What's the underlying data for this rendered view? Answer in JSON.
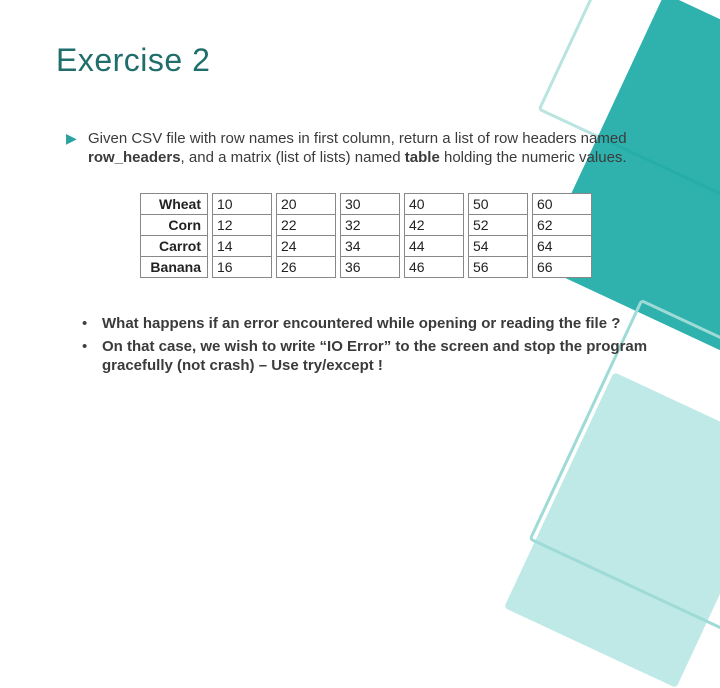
{
  "title": "Exercise 2",
  "bullet": {
    "pre": "Given CSV file with row names in first column, return a list of row headers named ",
    "kw1": "row_headers",
    "mid": ", and a matrix (list of lists) named ",
    "kw2": "table",
    "post": " holding the numeric values."
  },
  "table": {
    "rows": [
      {
        "label": "Wheat",
        "vals": [
          "10",
          "20",
          "30",
          "40",
          "50",
          "60"
        ]
      },
      {
        "label": "Corn",
        "vals": [
          "12",
          "22",
          "32",
          "42",
          "52",
          "62"
        ]
      },
      {
        "label": "Carrot",
        "vals": [
          "14",
          "24",
          "34",
          "44",
          "54",
          "64"
        ]
      },
      {
        "label": "Banana",
        "vals": [
          "16",
          "26",
          "36",
          "46",
          "56",
          "66"
        ]
      }
    ]
  },
  "questions": {
    "q1": "What happens if an error encountered while opening or reading the file ?",
    "q2": "On that case, we wish to write “IO Error” to the screen and stop the program gracefully (not crash) – Use try/except !"
  }
}
